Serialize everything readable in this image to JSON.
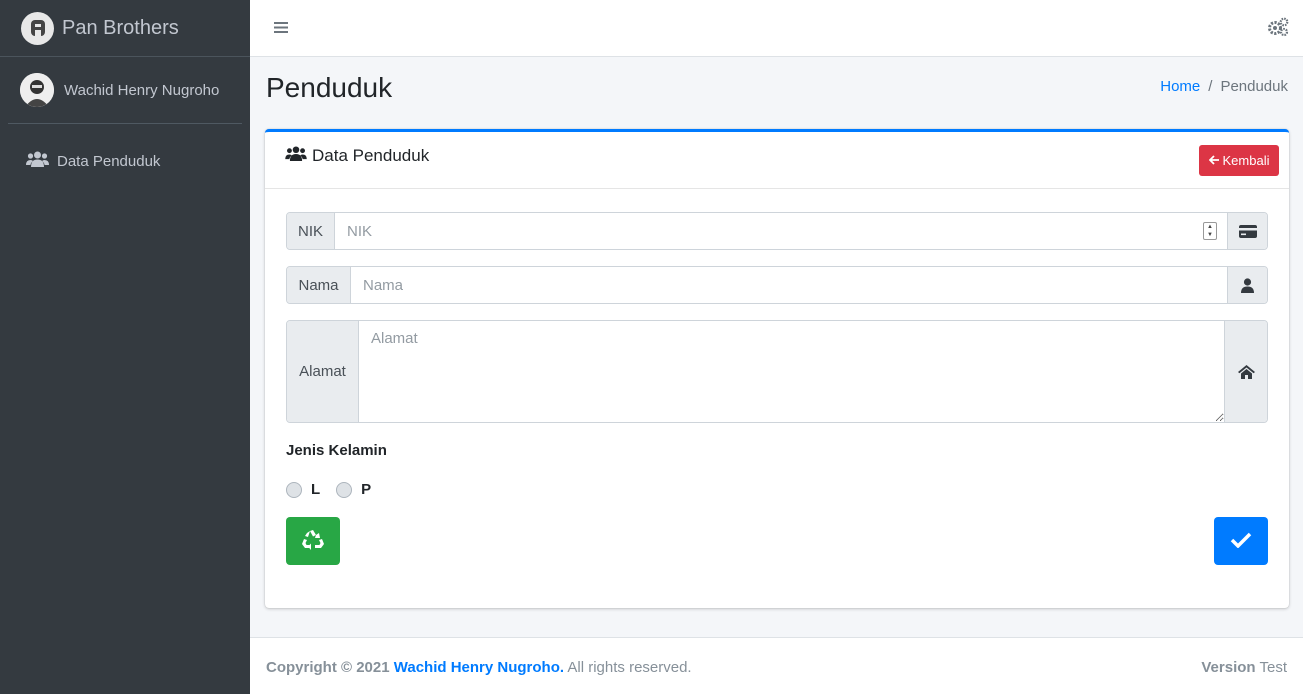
{
  "brand": {
    "name": "Pan Brothers",
    "logo_icon": "brand-logo-icon"
  },
  "user": {
    "name": "Wachid Henry Nugroho"
  },
  "sidebar": {
    "items": [
      {
        "label": "Data Penduduk",
        "icon": "users-icon"
      }
    ]
  },
  "header": {
    "page_title": "Penduduk",
    "breadcrumb": [
      "Home",
      "/",
      "Penduduk"
    ]
  },
  "card": {
    "title": "Data Penduduk",
    "back_button": "Kembali",
    "fields": {
      "nik": {
        "label": "NIK",
        "placeholder": "NIK",
        "value": ""
      },
      "nama": {
        "label": "Nama",
        "placeholder": "Nama",
        "value": ""
      },
      "alamat": {
        "label": "Alamat",
        "placeholder": "Alamat",
        "value": ""
      }
    },
    "gender": {
      "label": "Jenis Kelamin",
      "options": [
        "L",
        "P"
      ],
      "selected": null
    }
  },
  "footer": {
    "copyright_prefix": "Copyright © 2021",
    "author": "Wachid Henry Nugroho.",
    "rights": "All rights reserved.",
    "version_label": "Version",
    "version_value": "Test"
  },
  "colors": {
    "primary": "#007bff",
    "danger": "#dc3545",
    "success": "#28a745",
    "sidebar": "#343a40"
  }
}
